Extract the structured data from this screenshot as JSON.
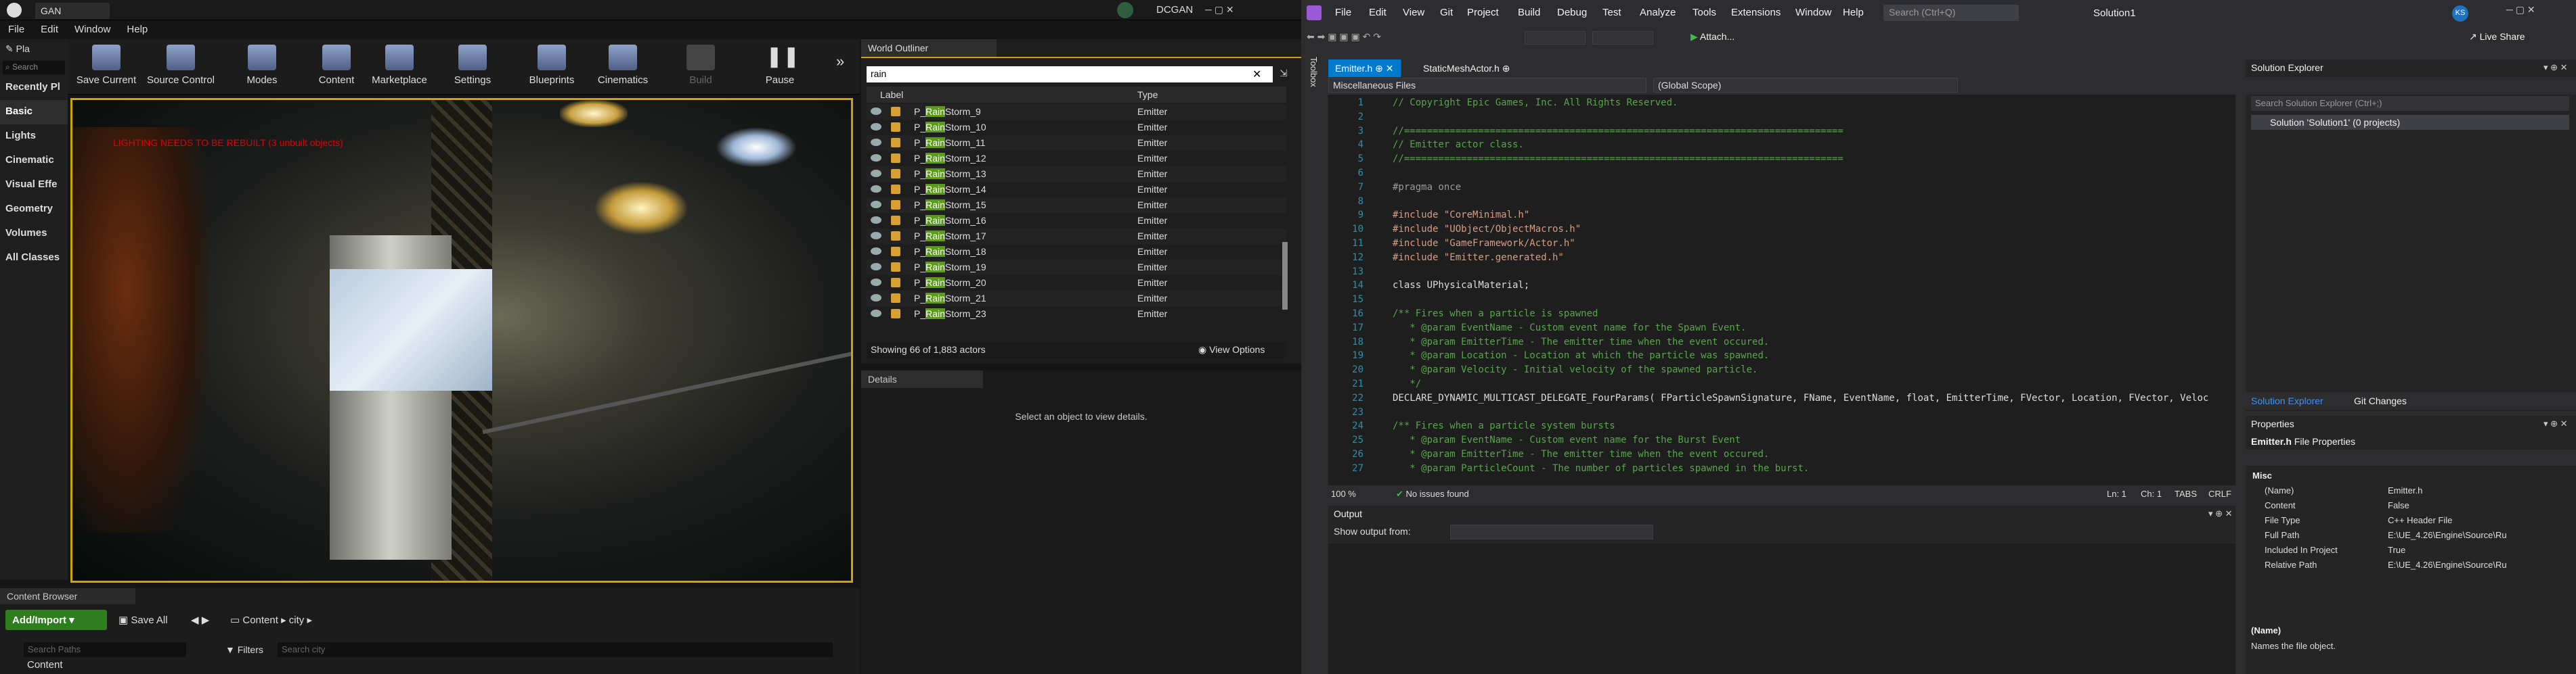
{
  "ue": {
    "title_tab": "GAN",
    "brand": "DCGAN",
    "menu": [
      "File",
      "Edit",
      "Window",
      "Help"
    ],
    "modes_tab": "Pla",
    "modes_search_placeholder": "Search",
    "modes": [
      "Recently Pl",
      "Basic",
      "Lights",
      "Cinematic",
      "Visual Effe",
      "Geometry",
      "Volumes",
      "All Classes"
    ],
    "toolbar": [
      "Save Current",
      "Source Control",
      "Modes",
      "Content",
      "Marketplace",
      "Settings",
      "Blueprints",
      "Cinematics",
      "Build",
      "Pause"
    ],
    "viewport_warning": "LIGHTING NEEDS TO BE REBUILT (3 unbuilt objects)",
    "outliner": {
      "tab": "World Outliner",
      "search": "rain",
      "col_label": "Label",
      "col_type": "Type",
      "rows": [
        {
          "pre": "P_",
          "hl": "Rain",
          "post": "Storm_9",
          "type": "Emitter"
        },
        {
          "pre": "P_",
          "hl": "Rain",
          "post": "Storm_10",
          "type": "Emitter"
        },
        {
          "pre": "P_",
          "hl": "Rain",
          "post": "Storm_11",
          "type": "Emitter"
        },
        {
          "pre": "P_",
          "hl": "Rain",
          "post": "Storm_12",
          "type": "Emitter"
        },
        {
          "pre": "P_",
          "hl": "Rain",
          "post": "Storm_13",
          "type": "Emitter"
        },
        {
          "pre": "P_",
          "hl": "Rain",
          "post": "Storm_14",
          "type": "Emitter"
        },
        {
          "pre": "P_",
          "hl": "Rain",
          "post": "Storm_15",
          "type": "Emitter"
        },
        {
          "pre": "P_",
          "hl": "Rain",
          "post": "Storm_16",
          "type": "Emitter"
        },
        {
          "pre": "P_",
          "hl": "Rain",
          "post": "Storm_17",
          "type": "Emitter"
        },
        {
          "pre": "P_",
          "hl": "Rain",
          "post": "Storm_18",
          "type": "Emitter"
        },
        {
          "pre": "P_",
          "hl": "Rain",
          "post": "Storm_19",
          "type": "Emitter"
        },
        {
          "pre": "P_",
          "hl": "Rain",
          "post": "Storm_20",
          "type": "Emitter"
        },
        {
          "pre": "P_",
          "hl": "Rain",
          "post": "Storm_21",
          "type": "Emitter"
        },
        {
          "pre": "P_",
          "hl": "Rain",
          "post": "Storm_23",
          "type": "Emitter"
        }
      ],
      "status": "Showing 66 of 1,883 actors",
      "view_options": "View Options"
    },
    "details": {
      "tab": "Details",
      "message": "Select an object to view details."
    },
    "content_browser": {
      "tab": "Content Browser",
      "add_import": "Add/Import",
      "save_all": "Save All",
      "path": [
        "Content",
        "city"
      ],
      "search_paths": "Search Paths",
      "filters": "Filters",
      "search_city": "Search city",
      "tree_root": "Content"
    }
  },
  "vs": {
    "menu": [
      "File",
      "Edit",
      "View",
      "Git",
      "Project",
      "Build",
      "Debug",
      "Test",
      "Analyze",
      "Tools",
      "Extensions",
      "Window",
      "Help"
    ],
    "search_placeholder": "Search (Ctrl+Q)",
    "solution_name": "Solution1",
    "user_initials": "KS",
    "live_share": "Live Share",
    "attach": "Attach...",
    "toolbox": "Toolbox",
    "tabs": [
      "Emitter.h",
      "StaticMeshActor.h"
    ],
    "nav_left": "Miscellaneous Files",
    "nav_right": "(Global Scope)",
    "code": [
      {
        "n": "1",
        "t": "// Copyright Epic Games, Inc. All Rights Reserved.",
        "c": "c-com"
      },
      {
        "n": "2",
        "t": "",
        "c": ""
      },
      {
        "n": "3",
        "t": "//=============================================================================",
        "c": "c-com"
      },
      {
        "n": "4",
        "t": "// Emitter actor class.",
        "c": "c-com"
      },
      {
        "n": "5",
        "t": "//=============================================================================",
        "c": "c-com"
      },
      {
        "n": "6",
        "t": "",
        "c": ""
      },
      {
        "n": "7",
        "t": "#pragma once",
        "c": "c-pp"
      },
      {
        "n": "8",
        "t": "",
        "c": ""
      },
      {
        "n": "9",
        "t": "#include \"CoreMinimal.h\"",
        "c": "c-str"
      },
      {
        "n": "10",
        "t": "#include \"UObject/ObjectMacros.h\"",
        "c": "c-str"
      },
      {
        "n": "11",
        "t": "#include \"GameFramework/Actor.h\"",
        "c": "c-str"
      },
      {
        "n": "12",
        "t": "#include \"Emitter.generated.h\"",
        "c": "c-str"
      },
      {
        "n": "13",
        "t": "",
        "c": ""
      },
      {
        "n": "14",
        "t": "class UPhysicalMaterial;",
        "c": ""
      },
      {
        "n": "15",
        "t": "",
        "c": ""
      },
      {
        "n": "16",
        "t": "/** Fires when a particle is spawned",
        "c": "c-com"
      },
      {
        "n": "17",
        "t": "   * @param EventName - Custom event name for the Spawn Event.",
        "c": "c-com"
      },
      {
        "n": "18",
        "t": "   * @param EmitterTime - The emitter time when the event occured.",
        "c": "c-com"
      },
      {
        "n": "19",
        "t": "   * @param Location - Location at which the particle was spawned.",
        "c": "c-com"
      },
      {
        "n": "20",
        "t": "   * @param Velocity - Initial velocity of the spawned particle.",
        "c": "c-com"
      },
      {
        "n": "21",
        "t": "   */",
        "c": "c-com"
      },
      {
        "n": "22",
        "t": "DECLARE_DYNAMIC_MULTICAST_DELEGATE_FourParams( FParticleSpawnSignature, FName, EventName, float, EmitterTime, FVector, Location, FVector, Veloc",
        "c": ""
      },
      {
        "n": "23",
        "t": "",
        "c": ""
      },
      {
        "n": "24",
        "t": "/** Fires when a particle system bursts",
        "c": "c-com"
      },
      {
        "n": "25",
        "t": "   * @param EventName - Custom event name for the Burst Event",
        "c": "c-com"
      },
      {
        "n": "26",
        "t": "   * @param EmitterTime - The emitter time when the event occured.",
        "c": "c-com"
      },
      {
        "n": "27",
        "t": "   * @param ParticleCount - The number of particles spawned in the burst.",
        "c": "c-com"
      }
    ],
    "status": {
      "zoom": "100 %",
      "issues": "No issues found",
      "ln": "Ln: 1",
      "ch": "Ch: 1",
      "tabs": "TABS",
      "crlf": "CRLF"
    },
    "output": {
      "title": "Output",
      "show_label": "Show output from:"
    },
    "solution_explorer": {
      "title": "Solution Explorer",
      "search": "Search Solution Explorer (Ctrl+;)",
      "item": "Solution 'Solution1' (0 projects)",
      "tab1": "Solution Explorer",
      "tab2": "Git Changes"
    },
    "properties": {
      "title": "Properties",
      "file": "Emitter.h",
      "file_kind": "File Properties",
      "section": "Misc",
      "rows": [
        {
          "k": "(Name)",
          "v": "Emitter.h"
        },
        {
          "k": "Content",
          "v": "False"
        },
        {
          "k": "File Type",
          "v": "C++ Header File"
        },
        {
          "k": "Full Path",
          "v": "E:\\UE_4.26\\Engine\\Source\\Ru"
        },
        {
          "k": "Included In Project",
          "v": "True"
        },
        {
          "k": "Relative Path",
          "v": "E:\\UE_4.26\\Engine\\Source\\Ru"
        }
      ],
      "desc_title": "(Name)",
      "desc_text": "Names the file object."
    }
  }
}
